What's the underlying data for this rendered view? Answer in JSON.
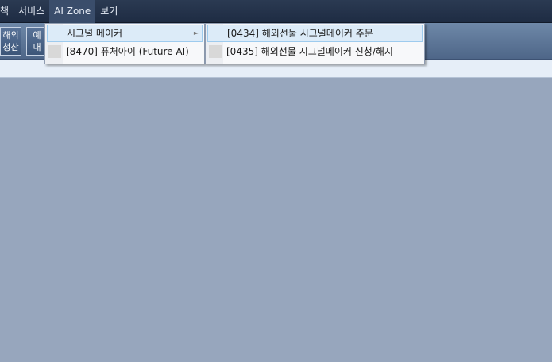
{
  "menubar": {
    "items": [
      {
        "label": "책"
      },
      {
        "label": "서비스"
      },
      {
        "label": "AI Zone"
      },
      {
        "label": "보기"
      }
    ]
  },
  "toolbar": {
    "buttons": [
      {
        "line1": "해외",
        "line2": "청산"
      },
      {
        "line1": "예",
        "line2": "내"
      }
    ]
  },
  "menu": {
    "items": [
      {
        "label": "시그널 메이커",
        "has_submenu": true
      },
      {
        "label": "[8470] 퓨처아이 (Future AI)"
      }
    ],
    "arrow_glyph": "►"
  },
  "submenu": {
    "items": [
      {
        "label": "[0434] 해외선물 시그널메이커 주문"
      },
      {
        "label": "[0435] 해외선물 시그널메이커 신청/해지"
      }
    ]
  },
  "colors": {
    "menubar_bg": "#1e2c43",
    "workspace_bg": "#97a6bd",
    "highlight": "#dcebf8"
  }
}
